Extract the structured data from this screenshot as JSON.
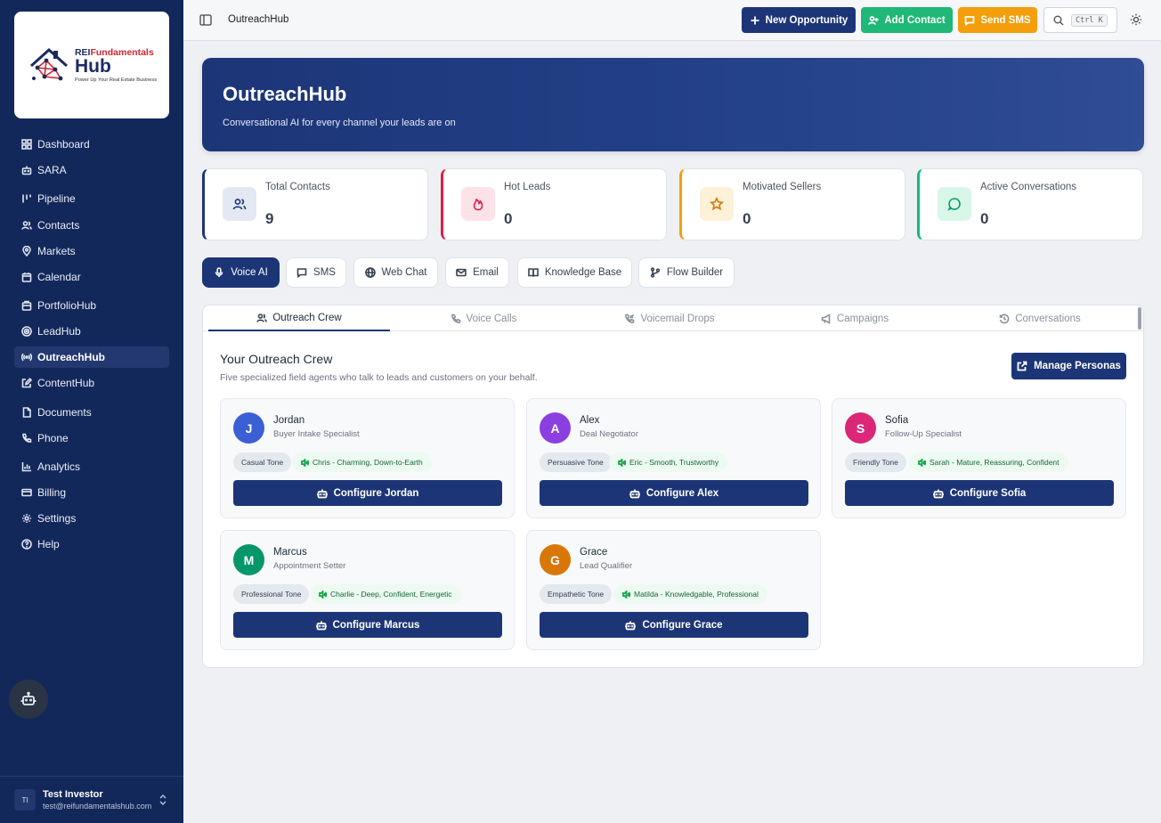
{
  "sidebar": {
    "logo": {
      "line1_a": "REI",
      "line1_b": "Fundamentals",
      "line2": "Hub",
      "tagline": "Power Up Your Real Estate Business"
    },
    "items": [
      {
        "label": "Dashboard",
        "icon": "dashboard-icon"
      },
      {
        "label": "SARA",
        "icon": "bot-icon"
      },
      {
        "label": "Pipeline",
        "icon": "pipeline-icon"
      },
      {
        "label": "Contacts",
        "icon": "users-icon"
      },
      {
        "label": "Markets",
        "icon": "map-pin-icon"
      },
      {
        "label": "Calendar",
        "icon": "calendar-icon"
      },
      {
        "label": "PortfolioHub",
        "icon": "building-icon"
      },
      {
        "label": "LeadHub",
        "icon": "target-icon"
      },
      {
        "label": "OutreachHub",
        "icon": "radio-icon"
      },
      {
        "label": "ContentHub",
        "icon": "edit-icon"
      },
      {
        "label": "Documents",
        "icon": "file-icon"
      },
      {
        "label": "Phone",
        "icon": "phone-icon"
      },
      {
        "label": "Analytics",
        "icon": "chart-icon"
      },
      {
        "label": "Billing",
        "icon": "card-icon"
      },
      {
        "label": "Settings",
        "icon": "gear-icon"
      },
      {
        "label": "Help",
        "icon": "help-icon"
      }
    ],
    "active": "OutreachHub",
    "user": {
      "initials": "TI",
      "name": "Test Investor",
      "email": "test@reifundamentalshub.com"
    }
  },
  "topbar": {
    "breadcrumb": "OutreachHub",
    "new_opportunity": "New Opportunity",
    "add_contact": "Add Contact",
    "send_sms": "Send SMS",
    "search_shortcut": "Ctrl K",
    "colors": {
      "primary": "#1c3577",
      "green": "#1fb876",
      "orange": "#f59e0b"
    }
  },
  "hero": {
    "title": "OutreachHub",
    "subtitle": "Conversational AI for every channel your leads are on"
  },
  "stats": [
    {
      "label": "Total Contacts",
      "value": "9",
      "color": "#1c3577"
    },
    {
      "label": "Hot Leads",
      "value": "0",
      "color": "#e11d48"
    },
    {
      "label": "Motivated Sellers",
      "value": "0",
      "color": "#f59e0b"
    },
    {
      "label": "Active Conversations",
      "value": "0",
      "color": "#10b981"
    }
  ],
  "channels": [
    "Voice AI",
    "SMS",
    "Web Chat",
    "Email",
    "Knowledge Base",
    "Flow Builder"
  ],
  "subtabs": [
    "Outreach Crew",
    "Voice Calls",
    "Voicemail Drops",
    "Campaigns",
    "Conversations"
  ],
  "crew": {
    "title": "Your Outreach Crew",
    "subtitle": "Five specialized field agents who talk to leads and customers on your behalf.",
    "manage_label": "Manage Personas",
    "agents": [
      {
        "initial": "J",
        "name": "Jordan",
        "role": "Buyer Intake Specialist",
        "tone": "Casual Tone",
        "voice": "Chris - Charming, Down-to-Earth",
        "button": "Configure Jordan",
        "color": "#3b5fd4"
      },
      {
        "initial": "A",
        "name": "Alex",
        "role": "Deal Negotiator",
        "tone": "Persuasive Tone",
        "voice": "Eric - Smooth, Trustworthy",
        "button": "Configure Alex",
        "color": "#8b3fe0"
      },
      {
        "initial": "S",
        "name": "Sofia",
        "role": "Follow-Up Specialist",
        "tone": "Friendly Tone",
        "voice": "Sarah - Mature, Reassuring, Confident",
        "button": "Configure Sofia",
        "color": "#db2777"
      },
      {
        "initial": "M",
        "name": "Marcus",
        "role": "Appointment Setter",
        "tone": "Professional Tone",
        "voice": "Charlie - Deep, Confident, Energetic",
        "button": "Configure Marcus",
        "color": "#059669"
      },
      {
        "initial": "G",
        "name": "Grace",
        "role": "Lead Qualifier",
        "tone": "Empathetic Tone",
        "voice": "Matilda - Knowledgable, Professional",
        "button": "Configure Grace",
        "color": "#d97706"
      }
    ]
  }
}
